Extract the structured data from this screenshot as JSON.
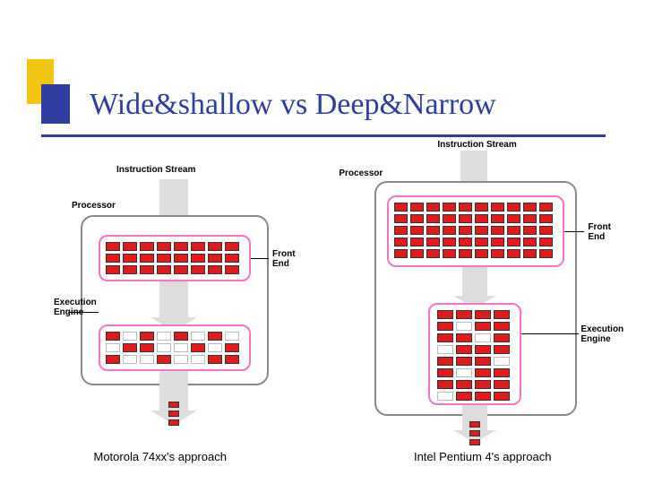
{
  "title": "Wide&shallow vs Deep&Narrow",
  "labels": {
    "instr_stream": "Instruction Stream",
    "processor": "Processor",
    "front_end": "Front\nEnd",
    "exec_engine": "Execution\nEngine"
  },
  "left": {
    "caption": "Motorola 74xx's approach",
    "stream": {
      "cols": 1,
      "rows": 3,
      "on": [
        1,
        1,
        1
      ]
    },
    "front_end": {
      "cols": 8,
      "rows": 3,
      "on": [
        1,
        1,
        1,
        1,
        1,
        1,
        1,
        1,
        1,
        1,
        1,
        1,
        1,
        1,
        1,
        1,
        1,
        1,
        1,
        1,
        1,
        1,
        1,
        1
      ]
    },
    "exec": {
      "cols": 8,
      "rows": 3,
      "on": [
        1,
        0,
        1,
        0,
        1,
        0,
        1,
        0,
        0,
        1,
        1,
        0,
        0,
        1,
        0,
        1,
        1,
        0,
        0,
        1,
        0,
        0,
        1,
        1
      ]
    },
    "out": {
      "cols": 1,
      "rows": 3,
      "on": [
        1,
        1,
        1
      ]
    }
  },
  "right": {
    "caption": "Intel Pentium 4's approach",
    "stream": {
      "cols": 1,
      "rows": 3,
      "on": [
        1,
        1,
        1
      ]
    },
    "front_end": {
      "cols": 10,
      "rows": 5,
      "on": [
        1,
        1,
        1,
        1,
        1,
        1,
        1,
        1,
        1,
        1,
        1,
        1,
        1,
        1,
        1,
        1,
        1,
        1,
        1,
        1,
        1,
        1,
        1,
        1,
        1,
        1,
        1,
        1,
        1,
        1,
        1,
        1,
        1,
        1,
        1,
        1,
        1,
        1,
        1,
        1,
        1,
        1,
        1,
        1,
        1,
        1,
        1,
        1,
        1,
        1
      ]
    },
    "exec": {
      "cols": 4,
      "rows": 8,
      "on": [
        1,
        1,
        1,
        1,
        1,
        0,
        1,
        1,
        1,
        1,
        0,
        1,
        0,
        1,
        1,
        1,
        1,
        1,
        1,
        0,
        1,
        0,
        1,
        1,
        1,
        1,
        1,
        1,
        0,
        1,
        1,
        1
      ]
    },
    "out": {
      "cols": 1,
      "rows": 3,
      "on": [
        1,
        1,
        1
      ]
    }
  }
}
